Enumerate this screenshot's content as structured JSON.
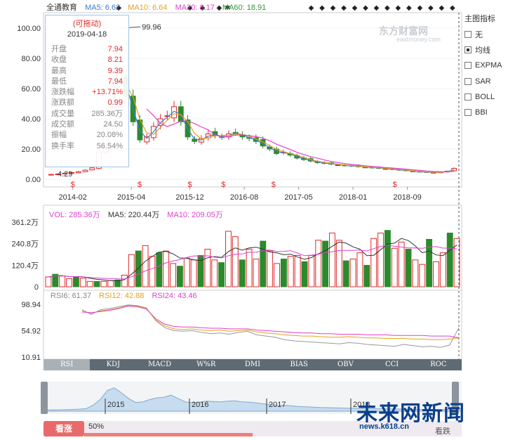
{
  "stock": {
    "name": "全通教育"
  },
  "ma_legend": [
    {
      "label": "MA5: 6.62",
      "color": "#3a7bd5"
    },
    {
      "label": "MA10: 6.64",
      "color": "#e6a21e"
    },
    {
      "label": "MA20: 8.17",
      "color": "#e040d0"
    },
    {
      "label": "MA60: 18.91",
      "color": "#2e9a3a"
    }
  ],
  "tooltip": {
    "title": "(可拖动)",
    "date": "2019-04-18",
    "rows": [
      {
        "k": "开盘",
        "v": "7.94"
      },
      {
        "k": "收盘",
        "v": "8.21"
      },
      {
        "k": "最高",
        "v": "9.39"
      },
      {
        "k": "最低",
        "v": "7.94"
      },
      {
        "k": "涨跌幅",
        "v": "+13.71%"
      },
      {
        "k": "涨跌额",
        "v": "0.99"
      },
      {
        "k": "成交量",
        "v": "285.36万"
      },
      {
        "k": "成交额",
        "v": "24.50"
      },
      {
        "k": "振幅",
        "v": "20.08%"
      },
      {
        "k": "换手率",
        "v": "56.54%"
      }
    ]
  },
  "side_panel": {
    "title": "主图指标",
    "items": [
      {
        "label": "无",
        "checked": false
      },
      {
        "label": "均线",
        "checked": true
      },
      {
        "label": "EXPMA",
        "checked": false
      },
      {
        "label": "SAR",
        "checked": false
      },
      {
        "label": "BOLL",
        "checked": false
      },
      {
        "label": "BBI",
        "checked": false
      }
    ]
  },
  "vol_legend": [
    {
      "label": "VOL: 285.36万",
      "color": "#e040d0"
    },
    {
      "label": "MA5: 220.44万",
      "color": "#333333"
    },
    {
      "label": "MA10: 209.05万",
      "color": "#e040d0"
    }
  ],
  "rsi_legend": [
    {
      "label": "RSI6: 61.37",
      "color": "#888888"
    },
    {
      "label": "RSI12: 42.88",
      "color": "#e6a21e"
    },
    {
      "label": "RSI24: 43.46",
      "color": "#e040d0"
    }
  ],
  "tabs": [
    "RSI",
    "KDJ",
    "MACD",
    "W%R",
    "DMI",
    "BIAS",
    "OBV",
    "CCI",
    "ROC"
  ],
  "navigator": {
    "years": [
      "2015",
      "2016",
      "2017",
      "2018"
    ]
  },
  "bottom": {
    "bull_label": "看涨",
    "bull_pct": "50%",
    "bull_fraction": 0.5,
    "bear_label": "看跌"
  },
  "eastmoney": {
    "logo_text": "东方财富网",
    "sub_text": "eastmoney.com"
  },
  "watermark": {
    "big": "未来网新闻",
    "small": "news.k618.cn"
  },
  "chart_data": [
    {
      "type": "candlestick",
      "title": "全通教育",
      "y_ticks": [
        "100.00",
        "80.00",
        "60.00",
        "40.00",
        "20.00",
        "0.00"
      ],
      "ylim": [
        0,
        100
      ],
      "x_ticks": [
        "2014-02",
        "2015-04",
        "2015-12",
        "2016-08",
        "2017-05",
        "2018-01",
        "2018-09"
      ],
      "annotations": {
        "high": "99.96",
        "low": "4.29"
      },
      "close": [
        3.2,
        3.5,
        4.0,
        4.4,
        5.0,
        6.0,
        7.5,
        18,
        35,
        62,
        70,
        55,
        38,
        26,
        28,
        35,
        40,
        42,
        48,
        38,
        28,
        25,
        27,
        30,
        29,
        28,
        30,
        31,
        28,
        27,
        25,
        22,
        20,
        17,
        18,
        16,
        14,
        13,
        12,
        11,
        10.5,
        10,
        9.5,
        9,
        8.7,
        8.3,
        8,
        7.5,
        7.2,
        7,
        6.5,
        6,
        5.6,
        5.2,
        4.8,
        4.6,
        4.5,
        4.8,
        5.3,
        7.2
      ]
    },
    {
      "type": "bar",
      "title": "VOL",
      "y_ticks": [
        "361.2万",
        "240.8万",
        "120.4万",
        "0"
      ],
      "ylim": [
        0,
        361.2
      ],
      "values": [
        55,
        70,
        60,
        45,
        55,
        48,
        30,
        30,
        30,
        35,
        38,
        65,
        180,
        200,
        230,
        170,
        190,
        200,
        130,
        115,
        160,
        150,
        175,
        210,
        150,
        135,
        310,
        280,
        150,
        210,
        155,
        255,
        200,
        130,
        155,
        170,
        175,
        140,
        175,
        260,
        255,
        300,
        260,
        145,
        155,
        190,
        120,
        270,
        300,
        315,
        215,
        250,
        210,
        150,
        125,
        265,
        140,
        190,
        300,
        270
      ]
    },
    {
      "type": "line",
      "title": "RSI",
      "y_ticks": [
        "98.94",
        "54.92",
        "10.91"
      ],
      "ylim": [
        10.91,
        98.94
      ],
      "series": [
        {
          "name": "RSI6",
          "values": [
            90,
            82,
            90,
            92,
            95,
            98,
            97,
            93,
            72,
            60,
            55,
            54,
            55,
            52,
            50,
            51,
            49,
            52,
            54,
            48,
            46,
            44,
            40,
            38,
            37,
            36,
            35,
            34,
            33,
            35,
            34,
            32,
            31,
            30,
            29,
            32,
            30,
            28,
            29,
            27,
            31,
            60
          ]
        },
        {
          "name": "RSI12",
          "values": [
            88,
            84,
            88,
            90,
            93,
            97,
            96,
            92,
            73,
            63,
            58,
            57,
            58,
            56,
            55,
            56,
            54,
            55,
            56,
            53,
            51,
            50,
            48,
            47,
            46,
            46,
            45,
            44,
            44,
            45,
            44,
            43,
            43,
            42,
            42,
            42,
            41,
            41,
            40,
            40,
            41,
            43
          ]
        },
        {
          "name": "RSI24",
          "values": [
            86,
            85,
            87,
            89,
            92,
            96,
            95,
            91,
            75,
            66,
            62,
            61,
            61,
            60,
            59,
            59,
            58,
            58,
            58,
            56,
            55,
            54,
            53,
            52,
            51,
            51,
            50,
            50,
            49,
            49,
            49,
            48,
            48,
            48,
            47,
            47,
            47,
            47,
            46,
            46,
            46,
            43
          ]
        }
      ]
    }
  ]
}
